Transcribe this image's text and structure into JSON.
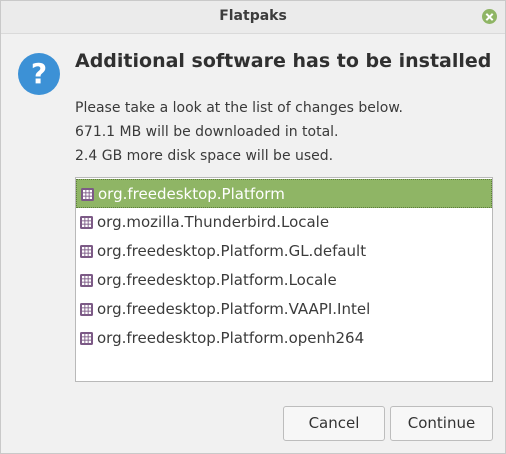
{
  "window": {
    "title": "Flatpaks"
  },
  "dialog": {
    "heading": "Additional software has to be installed",
    "lines": [
      "Please take a look at the list of changes below.",
      "671.1 MB will be downloaded in total.",
      "2.4 GB more disk space will be used."
    ]
  },
  "packages": [
    {
      "name": "org.freedesktop.Platform",
      "selected": true
    },
    {
      "name": "org.mozilla.Thunderbird.Locale",
      "selected": false
    },
    {
      "name": "org.freedesktop.Platform.GL.default",
      "selected": false
    },
    {
      "name": "org.freedesktop.Platform.Locale",
      "selected": false
    },
    {
      "name": "org.freedesktop.Platform.VAAPI.Intel",
      "selected": false
    },
    {
      "name": "org.freedesktop.Platform.openh264",
      "selected": false
    }
  ],
  "buttons": {
    "cancel": "Cancel",
    "continue": "Continue"
  },
  "icons": {
    "dialog": "question-icon",
    "close": "close-icon",
    "package": "package-icon"
  },
  "colors": {
    "accent": "#8fb565",
    "question": "#3c91d6",
    "package_icon": "#7c5a86"
  }
}
